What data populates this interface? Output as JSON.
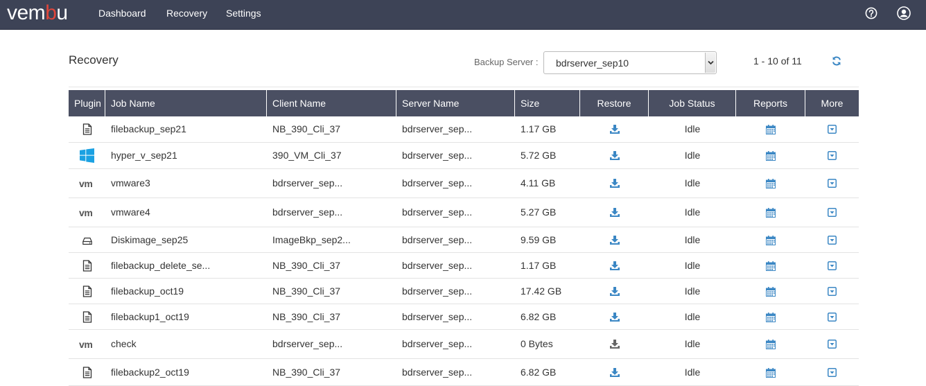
{
  "app": {
    "logo_prefix": "vem",
    "logo_accent": "b",
    "logo_suffix": "u",
    "nav": [
      "Dashboard",
      "Recovery",
      "Settings"
    ],
    "icons": {
      "help": "question-circle-icon",
      "user": "user-circle-icon"
    },
    "colors": {
      "topbar": "#3d4356",
      "logo_accent": "#e0463b",
      "table_header": "#4a4f62",
      "action_icon": "#3b87c4",
      "disabled_icon": "#666666"
    }
  },
  "header": {
    "title": "Recovery",
    "backup_server_label": "Backup Server :",
    "backup_server_value": "bdrserver_sep10",
    "pagination": "1 - 10 of 11"
  },
  "table": {
    "columns": [
      "Plugin",
      "Job Name",
      "Client Name",
      "Server Name",
      "Size",
      "Restore",
      "Job Status",
      "Reports",
      "More"
    ],
    "rows": [
      {
        "plugin": "file-document-icon",
        "job_name": "filebackup_sep21",
        "client_name": "NB_390_Cli_37",
        "server_name": "bdrserver_sep...",
        "size": "1.17 GB",
        "restore_enabled": true,
        "job_status": "Idle"
      },
      {
        "plugin": "windows-logo-icon",
        "job_name": "hyper_v_sep21",
        "client_name": "390_VM_Cli_37",
        "server_name": "bdrserver_sep...",
        "size": "5.72 GB",
        "restore_enabled": true,
        "job_status": "Idle"
      },
      {
        "plugin": "vm-logo-icon",
        "job_name": "vmware3",
        "client_name": "bdrserver_sep...",
        "server_name": "bdrserver_sep...",
        "size": "4.11 GB",
        "restore_enabled": true,
        "job_status": "Idle"
      },
      {
        "plugin": "vm-logo-icon",
        "job_name": "vmware4",
        "client_name": "bdrserver_sep...",
        "server_name": "bdrserver_sep...",
        "size": "5.27 GB",
        "restore_enabled": true,
        "job_status": "Idle"
      },
      {
        "plugin": "hard-drive-icon",
        "job_name": "Diskimage_sep25",
        "client_name": "ImageBkp_sep2...",
        "server_name": "bdrserver_sep...",
        "size": "9.59 GB",
        "restore_enabled": true,
        "job_status": "Idle"
      },
      {
        "plugin": "file-document-icon",
        "job_name": "filebackup_delete_se...",
        "client_name": "NB_390_Cli_37",
        "server_name": "bdrserver_sep...",
        "size": "1.17 GB",
        "restore_enabled": true,
        "job_status": "Idle"
      },
      {
        "plugin": "file-document-icon",
        "job_name": "filebackup_oct19",
        "client_name": "NB_390_Cli_37",
        "server_name": "bdrserver_sep...",
        "size": "17.42 GB",
        "restore_enabled": true,
        "job_status": "Idle"
      },
      {
        "plugin": "file-document-icon",
        "job_name": "filebackup1_oct19",
        "client_name": "NB_390_Cli_37",
        "server_name": "bdrserver_sep...",
        "size": "6.82 GB",
        "restore_enabled": true,
        "job_status": "Idle"
      },
      {
        "plugin": "vm-logo-icon",
        "job_name": "check",
        "client_name": "bdrserver_sep...",
        "server_name": "bdrserver_sep...",
        "size": "0 Bytes",
        "restore_enabled": false,
        "job_status": "Idle"
      },
      {
        "plugin": "file-document-icon",
        "job_name": "filebackup2_oct19",
        "client_name": "NB_390_Cli_37",
        "server_name": "bdrserver_sep...",
        "size": "6.82 GB",
        "restore_enabled": true,
        "job_status": "Idle"
      }
    ]
  }
}
